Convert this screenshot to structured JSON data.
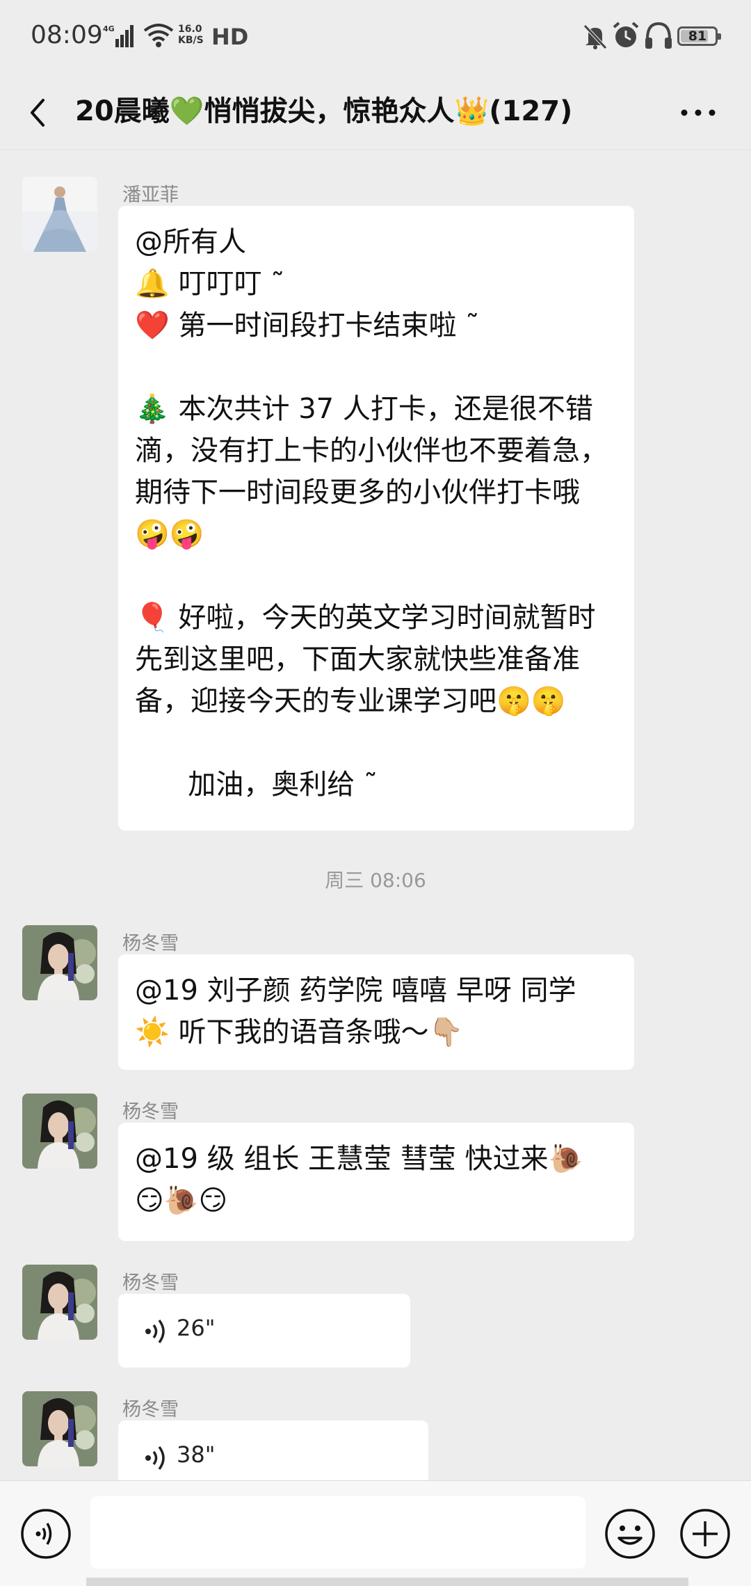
{
  "status_bar": {
    "time": "08:09",
    "network": "4G",
    "speed_value": "16.0",
    "speed_unit": "KB/S",
    "hd": "HD",
    "battery": "81",
    "battery_level": 0.81
  },
  "nav": {
    "title": "20晨曦💚悄悄拔尖，惊艳众人👑(127)"
  },
  "messages": [
    {
      "sender": "潘亚菲",
      "lines": [
        "@所有人",
        "🔔 叮叮叮 ˜",
        "❤️ 第一时间段打卡结束啦 ˜",
        "",
        "🎄 本次共计 37 人打卡，还是很不错",
        "滴，没有打上卡的小伙伴也不要着急，",
        "期待下一时间段更多的小伙伴打卡哦",
        "🤪🤪",
        "",
        "🎈 好啦，今天的英文学习时间就暂时",
        "先到这里吧，下面大家就快些准备准",
        "备，迎接今天的专业课学习吧🤫🤫",
        "",
        "      加油，奥利给 ˜"
      ]
    },
    {
      "time_divider": "周三 08:06"
    },
    {
      "sender": "杨冬雪",
      "lines": [
        "@19 刘子颜 药学院  嘻嘻  早呀 同学",
        "☀️ 听下我的语音条哦～👇🏼"
      ]
    },
    {
      "sender": "杨冬雪",
      "lines": [
        "@19 级 组长 王慧莹  彗莹 快过来🐌",
        "😏🐌😏"
      ]
    },
    {
      "sender": "杨冬雪",
      "voice": "26\""
    },
    {
      "sender": "杨冬雪",
      "voice": "38\""
    }
  ],
  "input_bar": {
    "placeholder": ""
  },
  "icons": {
    "back": "chevron-left-icon",
    "more": "more-dots-icon",
    "voice_toggle": "voice-icon",
    "emoji": "smiley-icon",
    "plus": "plus-circle-icon"
  },
  "colors": {
    "background": "#ededed",
    "bubble": "#ffffff",
    "secondary_text": "#8a8a8a"
  }
}
